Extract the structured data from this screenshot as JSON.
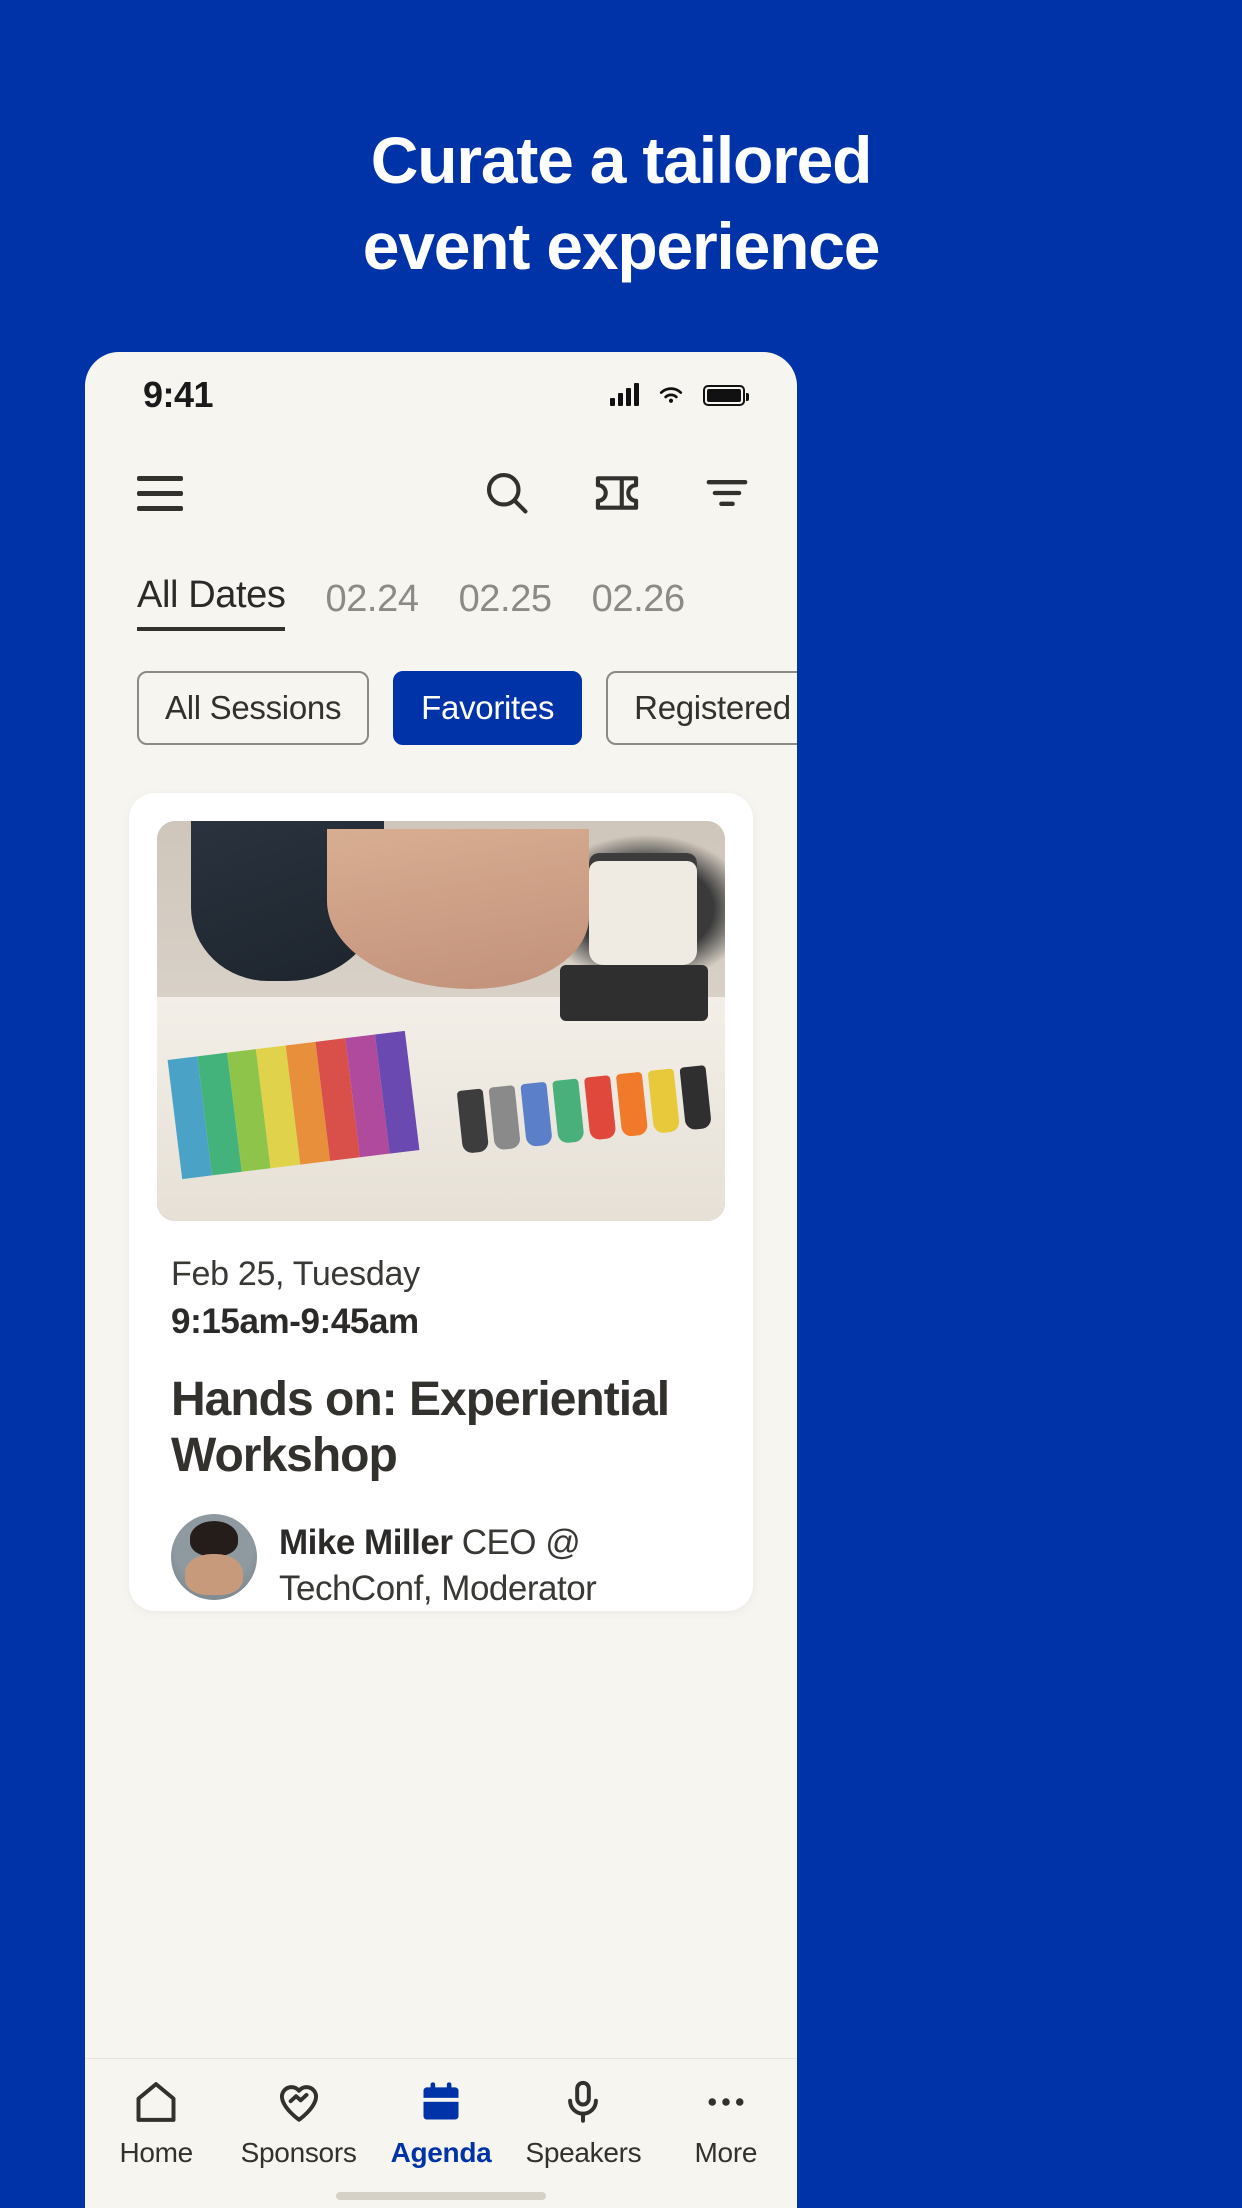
{
  "promo": {
    "line1": "Curate a tailored",
    "line2": "event experience"
  },
  "colors": {
    "brand_blue": "#0033A8",
    "app_bg": "#F7F5F0",
    "card_bg": "#FFFFFF",
    "text_dark": "#33312E",
    "text_muted": "#8C8A86"
  },
  "statusbar": {
    "time": "9:41",
    "signal_icon": "cellular-signal-icon",
    "wifi_icon": "wifi-icon",
    "battery_icon": "battery-icon"
  },
  "toolbar": {
    "menu_icon": "hamburger-menu-icon",
    "search_icon": "search-icon",
    "ticket_icon": "ticket-icon",
    "filter_icon": "filter-icon"
  },
  "date_tabs": [
    {
      "label": "All Dates",
      "active": true
    },
    {
      "label": "02.24",
      "active": false
    },
    {
      "label": "02.25",
      "active": false
    },
    {
      "label": "02.26",
      "active": false
    }
  ],
  "filter_chips": [
    {
      "label": "All Sessions",
      "active": false
    },
    {
      "label": "Favorites",
      "active": true
    },
    {
      "label": "Registered",
      "active": false
    }
  ],
  "session_card": {
    "image_alt": "designer-workspace-photo",
    "date": "Feb 25, Tuesday",
    "time": "9:15am-9:45am",
    "title": "Hands on: Experiential Workshop",
    "speaker": {
      "name": "Mike Miller",
      "role": "CEO @ TechConf, Moderator",
      "avatar": "speaker-avatar"
    }
  },
  "bottom_nav": [
    {
      "label": "Home",
      "icon": "home-icon",
      "active": false
    },
    {
      "label": "Sponsors",
      "icon": "handshake-heart-icon",
      "active": false
    },
    {
      "label": "Agenda",
      "icon": "calendar-icon",
      "active": true
    },
    {
      "label": "Speakers",
      "icon": "microphone-icon",
      "active": false
    },
    {
      "label": "More",
      "icon": "ellipsis-icon",
      "active": false
    }
  ]
}
